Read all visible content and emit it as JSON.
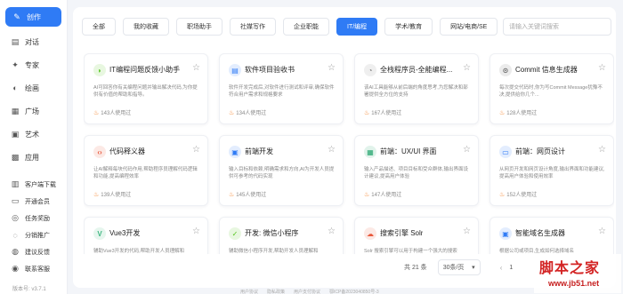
{
  "sidebar": {
    "items": [
      {
        "label": "创作",
        "icon": "pen-icon",
        "glyph": "✎"
      },
      {
        "label": "对话",
        "icon": "chat-icon",
        "glyph": "▤"
      },
      {
        "label": "专家",
        "icon": "expert-icon",
        "glyph": "✦"
      },
      {
        "label": "绘画",
        "icon": "palette-icon",
        "glyph": "◐"
      },
      {
        "label": "广场",
        "icon": "square-icon",
        "glyph": "▦"
      },
      {
        "label": "艺术",
        "icon": "art-icon",
        "glyph": "▣"
      },
      {
        "label": "应用",
        "icon": "apps-icon",
        "glyph": "▩"
      },
      {
        "label": "客户端下载",
        "icon": "download-icon",
        "glyph": "▥"
      },
      {
        "label": "开通会员",
        "icon": "vip-icon",
        "glyph": "▭"
      },
      {
        "label": "任务奖励",
        "icon": "task-icon",
        "glyph": "◎"
      },
      {
        "label": "分销推广",
        "icon": "share-icon",
        "glyph": "◌"
      },
      {
        "label": "建议反馈",
        "icon": "feedback-icon",
        "glyph": "◍"
      },
      {
        "label": "联系客服",
        "icon": "service-icon",
        "glyph": "◉"
      }
    ],
    "version": "版本号: v3.7.1"
  },
  "tabs": [
    {
      "label": "全部"
    },
    {
      "label": "我的收藏"
    },
    {
      "label": "职场助手"
    },
    {
      "label": "社媒写作"
    },
    {
      "label": "企业职能"
    },
    {
      "label": "IT/编程",
      "active": true
    },
    {
      "label": "学术/教育"
    },
    {
      "label": "网站/电商/SE"
    }
  ],
  "search": {
    "placeholder": "请输入关键词搜索"
  },
  "cards": [
    {
      "title": "IT编程问题反馈小助手",
      "desc": "AI可回答你有关编程问题并输出解决代码,为你提供有价值的帮助和指导。",
      "uses": "143人使用过",
      "icon": "lightbulb-icon",
      "glyph": "◗",
      "color": "#52c41a"
    },
    {
      "title": "软件项目验收书",
      "desc": "软件开发完成后,对软件进行测试和评审,确保软件符合用户需求和规格要求",
      "uses": "134人使用过",
      "icon": "document-icon",
      "glyph": "▤",
      "color": "#2f7bf5"
    },
    {
      "title": "全栈程序员-全能编程...",
      "desc": "该AI工具能够从前后端的角度思考,为您解决和部署提供全方位的支持",
      "uses": "167人使用过",
      "icon": "person-icon",
      "glyph": "◔",
      "color": "#888888"
    },
    {
      "title": "Commit 信息生成器",
      "desc": "每次提交代码时,你为写Commit Message犹豫不决,提供给你几个...",
      "uses": "128人使用过",
      "icon": "commit-icon",
      "glyph": "⊙",
      "color": "#666666"
    },
    {
      "title": "代码释义器",
      "desc": "让AI解释每块代码作用,帮助程序员理解代码逻辑和功能,提高编程效率",
      "uses": "139人使用过",
      "icon": "code-icon",
      "glyph": "‹›",
      "color": "#e8583b"
    },
    {
      "title": "前端开发",
      "desc": "输入目标和依赖,明确需求和方向,AI为开发人员提供可参考的代码实现",
      "uses": "145人使用过",
      "icon": "frontend-icon",
      "glyph": "▣",
      "color": "#2f7bf5"
    },
    {
      "title": "前端：UX/UI 界面",
      "desc": "输入产品描述、项目目标和受众群体,输出界面设计建议,提高用户体验",
      "uses": "147人使用过",
      "icon": "layout-icon",
      "glyph": "▦",
      "color": "#20a36b"
    },
    {
      "title": "前端：网页设计",
      "desc": "从网页开发和网页设计角度,输出界面和功能建议,提高用户体验和使用效率",
      "uses": "152人使用过",
      "icon": "webdesign-icon",
      "glyph": "▭",
      "color": "#2f7bf5"
    },
    {
      "title": "Vue3开发",
      "desc": "辅助Vue3开发的代码,帮助开发人员理解和",
      "uses": "",
      "icon": "vue-icon",
      "glyph": "V",
      "color": "#41b883"
    },
    {
      "title": "开发: 微信小程序",
      "desc": "辅助微信小程序开发,帮助开发人员理解和",
      "uses": "",
      "icon": "wechat-icon",
      "glyph": "✓",
      "color": "#52c41a"
    },
    {
      "title": "搜索引擎 Solr",
      "desc": "Solr 搜索引擎可以用于构建一个强大的搜索",
      "uses": "",
      "icon": "search-engine-icon",
      "glyph": "☁",
      "color": "#e8583b"
    },
    {
      "title": "智能域名生成器",
      "desc": "根据公司或项目,生成如何选择域名",
      "uses": "",
      "icon": "domain-icon",
      "glyph": "▣",
      "color": "#2f7bf5"
    }
  ],
  "pagination": {
    "total": "共 21 条",
    "page_size": "30条/页",
    "prev": "‹",
    "page": "1"
  },
  "footer": {
    "links": [
      "用户协议",
      "隐私政策",
      "用户支付协议",
      "鄂ICP备2023040850号-3"
    ]
  },
  "watermark": {
    "logo": "脚本之家",
    "url": "www.jb51.net"
  }
}
